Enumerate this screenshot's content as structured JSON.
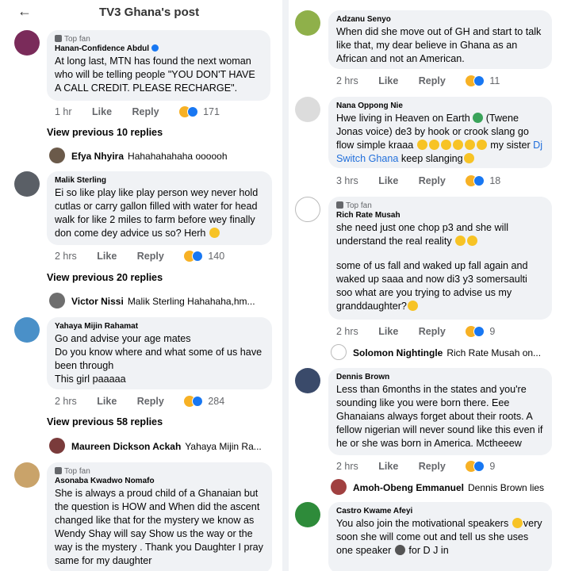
{
  "header": {
    "back_icon": "←",
    "title": "TV3 Ghana's post"
  },
  "top_fan_label": "Top fan",
  "view_prev": [
    "View previous 10 replies",
    "View previous 20 replies",
    "View previous 58 replies"
  ],
  "actions": {
    "like": "Like",
    "reply": "Reply"
  },
  "left": {
    "c1": {
      "author": "Hanan-Confidence Abdul",
      "text": "At long last, MTN has found the next woman who will be telling people \"YOU DON'T HAVE A CALL CREDIT. PLEASE RECHARGE\".",
      "time": "1 hr",
      "count": "171"
    },
    "r1": {
      "name": "Efya Nhyira",
      "text": "Hahahahahaha oooooh"
    },
    "c2": {
      "author": "Malik Sterling",
      "text": "Ei so like play like play person wey never hold cutlas or carry gallon filled with water for head walk for like 2 miles to farm before wey finally don come dey advice us so? Herh",
      "time": "2 hrs",
      "count": "140"
    },
    "r2": {
      "name": "Victor Nissi",
      "text": "Malik Sterling Hahahaha,hm..."
    },
    "c3": {
      "author": "Yahaya Mijin Rahamat",
      "line1": "Go and advise your age mates",
      "line2": "Do you know where and what some of us have been through",
      "line3": "This girl paaaaa",
      "time": "2 hrs",
      "count": "284"
    },
    "r3": {
      "name": "Maureen Dickson Ackah",
      "text": "Yahaya Mijin Ra..."
    },
    "c4": {
      "author": "Asonaba Kwadwo Nomafo",
      "text": "She is always a proud child of a Ghanaian but the question is HOW and When did the ascent changed like that for the mystery we know as Wendy Shay will say Show us the way or the way is the mystery . Thank you Daughter I pray same for my daughter"
    }
  },
  "right": {
    "c1": {
      "author": "Adzanu Senyo",
      "text": "When did she move out of GH and start to talk like that, my dear believe in Ghana as an African and not an American.",
      "time": "2 hrs",
      "count": "11"
    },
    "c2": {
      "author": "Nana Oppong Nie",
      "text_a": "Hwe living in Heaven on Earth",
      "text_b": "(Twene Jonas voice) de3 by hook or crook slang go flow simple kraaa",
      "text_c": "my sister",
      "link": "Dj Switch Ghana",
      "text_d": "keep slanging",
      "time": "3 hrs",
      "count": "18"
    },
    "c3": {
      "author": "Rich Rate Musah",
      "p1": "she need just one chop p3 and she will understand the real reality",
      "p2": "some of us fall and waked up fall again and waked up saaa and now di3 y3  somersaulti soo what are you trying to advise us my granddaughter?",
      "time": "2 hrs",
      "count": "9"
    },
    "r3": {
      "name": "Solomon Nightingle",
      "text": "Rich Rate Musah on..."
    },
    "c4": {
      "author": "Dennis Brown",
      "text": "Less than 6months in the states and you're sounding like you were born there. Eee Ghanaians always forget about their roots. A fellow nigerian will never sound like this even if he or she was born in America. Mctheeew",
      "time": "2 hrs",
      "count": "9"
    },
    "r4": {
      "name": "Amoh-Obeng Emmanuel",
      "text": "Dennis Brown lies"
    },
    "c5": {
      "author": "Castro Kwame Afeyi",
      "text": "You also join the motivational speakers",
      "text_b": "very soon she will come out and tell us she uses one speaker",
      "text_c": "for D J in"
    }
  },
  "colors": {
    "bubble": "#f0f2f5",
    "meta": "#65676b",
    "link": "#216fdb",
    "verified": "#1877f2"
  }
}
